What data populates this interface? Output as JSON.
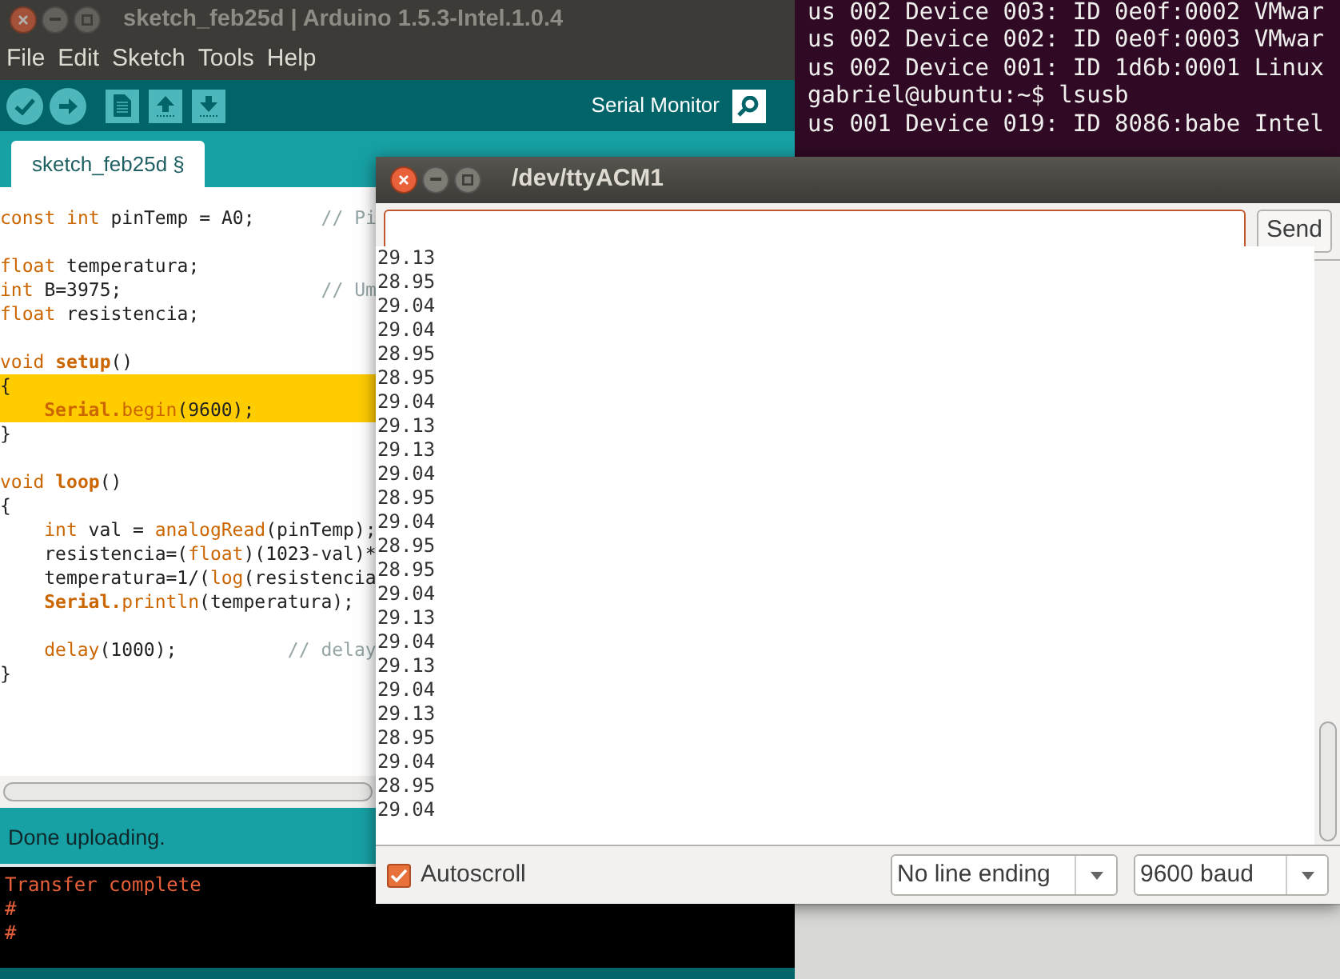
{
  "terminal": {
    "lines": [
      "us 002 Device 003: ID 0e0f:0002 VMwar",
      "us 002 Device 002: ID 0e0f:0003 VMwar",
      "us 002 Device 001: ID 1d6b:0001 Linux",
      "gabriel@ubuntu:~$ lsusb",
      "us 001 Device 019: ID 8086:babe Intel"
    ]
  },
  "ide": {
    "title": "sketch_feb25d | Arduino 1.5.3-Intel.1.0.4",
    "menu": [
      "File",
      "Edit",
      "Sketch",
      "Tools",
      "Help"
    ],
    "toolbar": [
      {
        "kind": "verify"
      },
      {
        "kind": "upload"
      },
      {
        "kind": "new"
      },
      {
        "kind": "open"
      },
      {
        "kind": "save"
      }
    ],
    "serial_monitor_label": "Serial Monitor",
    "tabs": [
      {
        "label": "sketch_feb25d §",
        "selected": true
      }
    ],
    "code": [
      {
        "highlighted": false,
        "blank_before": false,
        "indented": false,
        "segments": [
          {
            "kind": "type",
            "text": "const int"
          },
          {
            "kind": "plain",
            "text": " pinTemp = A0;      "
          },
          {
            "kind": "comment",
            "text": "// Pi"
          }
        ]
      },
      {
        "highlighted": false,
        "blank_before": true,
        "indented": false,
        "segments": [
          {
            "kind": "type",
            "text": "float"
          },
          {
            "kind": "plain",
            "text": " temperatura;"
          }
        ]
      },
      {
        "highlighted": false,
        "blank_before": false,
        "indented": false,
        "segments": [
          {
            "kind": "type",
            "text": "int"
          },
          {
            "kind": "plain",
            "text": " B=3975;                  "
          },
          {
            "kind": "comment",
            "text": "// Um"
          }
        ]
      },
      {
        "highlighted": false,
        "blank_before": false,
        "indented": false,
        "segments": [
          {
            "kind": "type",
            "text": "float"
          },
          {
            "kind": "plain",
            "text": " resistencia;"
          }
        ]
      },
      {
        "highlighted": false,
        "blank_before": true,
        "indented": false,
        "segments": [
          {
            "kind": "type",
            "text": "void "
          },
          {
            "kind": "function",
            "text": "setup"
          },
          {
            "kind": "plain",
            "text": "()"
          }
        ]
      },
      {
        "highlighted": true,
        "blank_before": false,
        "indented": false,
        "segments": [
          {
            "kind": "plain",
            "text": "{"
          }
        ]
      },
      {
        "highlighted": true,
        "blank_before": false,
        "indented": true,
        "segments": [
          {
            "kind": "function",
            "text": "Serial."
          },
          {
            "kind": "method",
            "text": "begin"
          },
          {
            "kind": "plain",
            "text": "(9600);"
          }
        ]
      },
      {
        "highlighted": false,
        "blank_before": false,
        "indented": false,
        "segments": [
          {
            "kind": "plain",
            "text": "}"
          }
        ]
      },
      {
        "highlighted": false,
        "blank_before": true,
        "indented": false,
        "segments": [
          {
            "kind": "type",
            "text": "void "
          },
          {
            "kind": "function",
            "text": "loop"
          },
          {
            "kind": "plain",
            "text": "()"
          }
        ]
      },
      {
        "highlighted": false,
        "blank_before": false,
        "indented": false,
        "segments": [
          {
            "kind": "plain",
            "text": "{"
          }
        ]
      },
      {
        "highlighted": false,
        "blank_before": false,
        "indented": true,
        "segments": [
          {
            "kind": "type",
            "text": "int"
          },
          {
            "kind": "plain",
            "text": " val = "
          },
          {
            "kind": "method",
            "text": "analogRead"
          },
          {
            "kind": "plain",
            "text": "(pinTemp);"
          }
        ]
      },
      {
        "highlighted": false,
        "blank_before": false,
        "indented": true,
        "segments": [
          {
            "kind": "plain",
            "text": "resistencia=("
          },
          {
            "kind": "type",
            "text": "float"
          },
          {
            "kind": "plain",
            "text": ")(1023-val)*"
          }
        ]
      },
      {
        "highlighted": false,
        "blank_before": false,
        "indented": true,
        "segments": [
          {
            "kind": "plain",
            "text": "temperatura=1/("
          },
          {
            "kind": "method",
            "text": "log"
          },
          {
            "kind": "plain",
            "text": "(resistencia"
          }
        ]
      },
      {
        "highlighted": false,
        "blank_before": false,
        "indented": true,
        "segments": [
          {
            "kind": "function",
            "text": "Serial."
          },
          {
            "kind": "method",
            "text": "println"
          },
          {
            "kind": "plain",
            "text": "(temperatura);"
          }
        ]
      },
      {
        "highlighted": false,
        "blank_before": true,
        "indented": true,
        "segments": [
          {
            "kind": "method",
            "text": "delay"
          },
          {
            "kind": "plain",
            "text": "(1000);          "
          },
          {
            "kind": "comment",
            "text": "// delay"
          }
        ]
      },
      {
        "highlighted": false,
        "blank_before": false,
        "indented": false,
        "segments": [
          {
            "kind": "plain",
            "text": "}"
          }
        ]
      }
    ],
    "status": "Done uploading.",
    "console": [
      "Transfer complete",
      "#",
      "#"
    ]
  },
  "serial_monitor": {
    "title": "/dev/ttyACM1",
    "send": "Send",
    "output": [
      "29.13",
      "28.95",
      "29.04",
      "29.04",
      "28.95",
      "28.95",
      "29.04",
      "29.13",
      "29.13",
      "29.04",
      "28.95",
      "29.04",
      "28.95",
      "28.95",
      "29.04",
      "29.13",
      "29.04",
      "29.13",
      "29.04",
      "29.13",
      "28.95",
      "29.04",
      "28.95",
      "29.04"
    ],
    "autoscroll": {
      "label": "Autoscroll",
      "checked": true
    },
    "line_ending": "No line ending",
    "baud": "9600 baud"
  }
}
